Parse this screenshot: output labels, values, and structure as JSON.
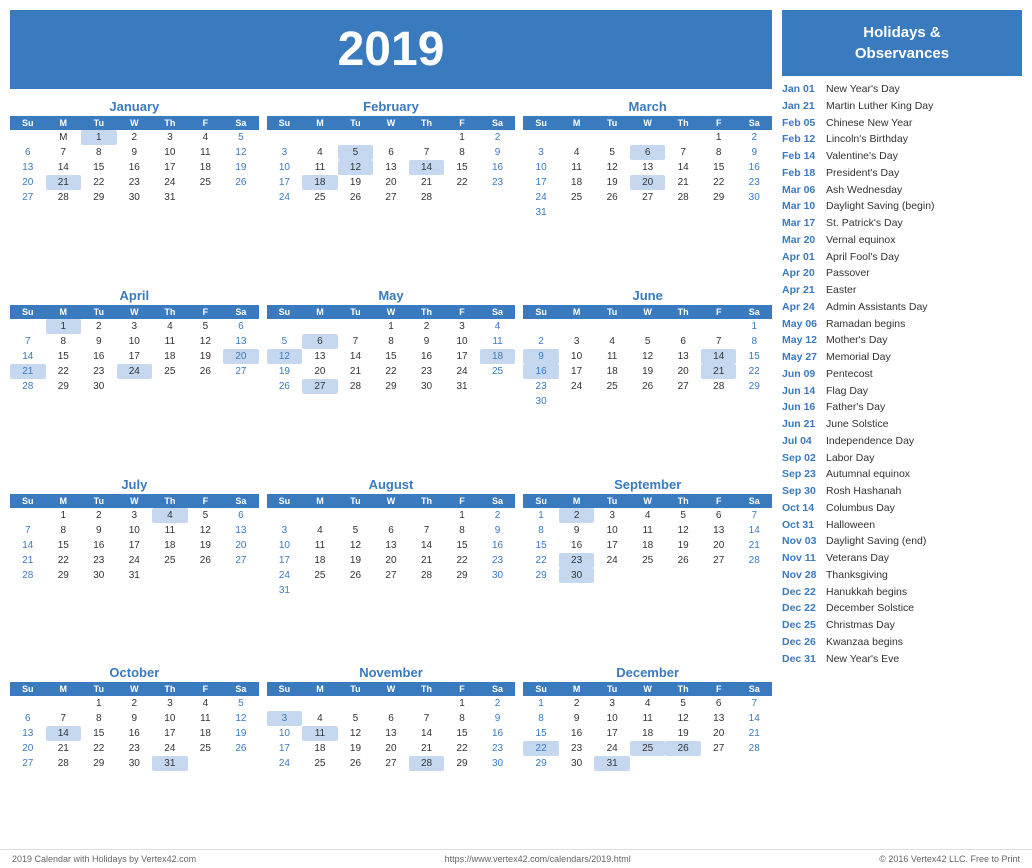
{
  "header": {
    "year": "2019"
  },
  "holidays_panel": {
    "title": "Holidays &\nObservances",
    "items": [
      {
        "date": "Jan 01",
        "name": "New Year's Day"
      },
      {
        "date": "Jan 21",
        "name": "Martin Luther King Day"
      },
      {
        "date": "Feb 05",
        "name": "Chinese New Year"
      },
      {
        "date": "Feb 12",
        "name": "Lincoln's Birthday"
      },
      {
        "date": "Feb 14",
        "name": "Valentine's Day"
      },
      {
        "date": "Feb 18",
        "name": "President's Day"
      },
      {
        "date": "Mar 06",
        "name": "Ash Wednesday"
      },
      {
        "date": "Mar 10",
        "name": "Daylight Saving (begin)"
      },
      {
        "date": "Mar 17",
        "name": "St. Patrick's Day"
      },
      {
        "date": "Mar 20",
        "name": "Vernal equinox"
      },
      {
        "date": "Apr 01",
        "name": "April Fool's Day"
      },
      {
        "date": "Apr 20",
        "name": "Passover"
      },
      {
        "date": "Apr 21",
        "name": "Easter"
      },
      {
        "date": "Apr 24",
        "name": "Admin Assistants Day"
      },
      {
        "date": "May 06",
        "name": "Ramadan begins"
      },
      {
        "date": "May 12",
        "name": "Mother's Day"
      },
      {
        "date": "May 27",
        "name": "Memorial Day"
      },
      {
        "date": "Jun 09",
        "name": "Pentecost"
      },
      {
        "date": "Jun 14",
        "name": "Flag Day"
      },
      {
        "date": "Jun 16",
        "name": "Father's Day"
      },
      {
        "date": "Jun 21",
        "name": "June Solstice"
      },
      {
        "date": "Jul 04",
        "name": "Independence Day"
      },
      {
        "date": "Sep 02",
        "name": "Labor Day"
      },
      {
        "date": "Sep 23",
        "name": "Autumnal equinox"
      },
      {
        "date": "Sep 30",
        "name": "Rosh Hashanah"
      },
      {
        "date": "Oct 14",
        "name": "Columbus Day"
      },
      {
        "date": "Oct 31",
        "name": "Halloween"
      },
      {
        "date": "Nov 03",
        "name": "Daylight Saving (end)"
      },
      {
        "date": "Nov 11",
        "name": "Veterans Day"
      },
      {
        "date": "Nov 28",
        "name": "Thanksgiving"
      },
      {
        "date": "Dec 22",
        "name": "Hanukkah begins"
      },
      {
        "date": "Dec 22",
        "name": "December Solstice"
      },
      {
        "date": "Dec 25",
        "name": "Christmas Day"
      },
      {
        "date": "Dec 26",
        "name": "Kwanzaa begins"
      },
      {
        "date": "Dec 31",
        "name": "New Year's Eve"
      }
    ]
  },
  "footer": {
    "left": "2019 Calendar with Holidays by Vertex42.com",
    "center": "https://www.vertex42.com/calendars/2019.html",
    "right": "© 2016 Vertex42 LLC. Free to Print"
  }
}
